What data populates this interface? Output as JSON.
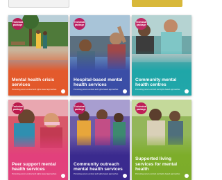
{
  "badge_text": "Technical package",
  "subtitle": "Promoting person-centred and rights-based approaches",
  "org_mark": "World Health Organization",
  "cards": [
    {
      "title": "Mental health crisis services",
      "accent": "#e35a2c",
      "badge_color": "#b51f57"
    },
    {
      "title": "Hospital-based mental health services",
      "accent": "#3b4ea6",
      "badge_color": "#ba2062"
    },
    {
      "title": "Community mental health centres",
      "accent": "#1fa6a8",
      "badge_color": "#c02a66"
    },
    {
      "title": "Peer support mental health services",
      "accent": "#e2407c",
      "badge_color": "#bb1b4d"
    },
    {
      "title": "Community outreach mental health services",
      "accent": "#3a2a8e",
      "badge_color": "#b71b57"
    },
    {
      "title": "Supported living services for mental health",
      "accent": "#7dad2a",
      "badge_color": "#bd1f56"
    }
  ]
}
